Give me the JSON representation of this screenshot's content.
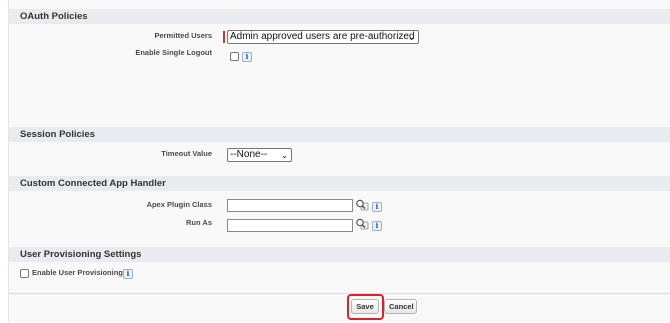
{
  "oauth": {
    "header": "OAuth Policies",
    "permitted_users_label": "Permitted Users",
    "permitted_users_value": "Admin approved users are pre-authorized",
    "single_logout_label": "Enable Single Logout"
  },
  "session": {
    "header": "Session Policies",
    "timeout_label": "Timeout Value",
    "timeout_value": "--None--"
  },
  "handler": {
    "header": "Custom Connected App Handler",
    "apex_plugin_label": "Apex Plugin Class",
    "apex_plugin_value": "",
    "run_as_label": "Run As",
    "run_as_value": ""
  },
  "provisioning": {
    "header": "User Provisioning Settings",
    "enable_label": "Enable User Provisioning"
  },
  "footer": {
    "save_label": "Save",
    "cancel_label": "Cancel"
  },
  "icons": {
    "info": "i",
    "info_icon": "info-icon",
    "lookup_icon": "lookup-magnifier-icon",
    "dropdown_icon": "chevron-down-icon"
  },
  "colors": {
    "section_header_bg": "#e8ecf1",
    "required_bar": "#c23934",
    "highlight": "#d8232a"
  }
}
